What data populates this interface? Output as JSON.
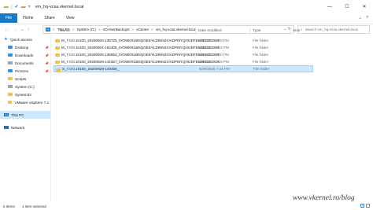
{
  "window": {
    "title": "vm_hq-vcsa.vkernel.local",
    "controls": {
      "minimize": "—",
      "maximize": "☐",
      "close": "✕"
    }
  },
  "quick_access_toolbar": {
    "icons": [
      "folder-icon",
      "check-icon",
      "folder-icon"
    ],
    "divider": "|",
    "dropdown": "▾"
  },
  "ribbon": {
    "tabs": [
      "File",
      "Home",
      "Share",
      "View"
    ],
    "expand_icon": "⌄",
    "help_icon": "?"
  },
  "navigation": {
    "back": "←",
    "forward": "→",
    "history": "⌄",
    "up": "↑"
  },
  "address_bar": {
    "segments": [
      "This PC",
      "System (C:)",
      "vCenterBackups",
      "vCenter",
      "vm_hq-vcsa.vkernel.local"
    ],
    "separator": ">",
    "dropdown": "⌄",
    "refresh": "↻"
  },
  "search": {
    "placeholder": "Search vm_hq-vcsa.vkernel.local"
  },
  "sidebar": {
    "items": [
      {
        "label": "Quick access",
        "icon": "star-icon",
        "level": 1
      },
      {
        "label": "Desktop",
        "icon": "desktop-icon",
        "level": 2,
        "pinned": true
      },
      {
        "label": "Downloads",
        "icon": "downloads-icon",
        "level": 2,
        "pinned": true
      },
      {
        "label": "Documents",
        "icon": "documents-icon",
        "level": 2,
        "pinned": true
      },
      {
        "label": "Pictures",
        "icon": "pictures-icon",
        "level": 2,
        "pinned": true
      },
      {
        "label": "Scripts",
        "icon": "folder-icon",
        "level": 2
      },
      {
        "label": "System (C:)",
        "icon": "drive-icon",
        "level": 2
      },
      {
        "label": "System32",
        "icon": "folder-icon",
        "level": 2
      },
      {
        "label": "VMware vSphere 7.x",
        "icon": "folder-icon",
        "level": 2
      },
      {
        "label": "This PC",
        "icon": "pc-icon",
        "level": 1,
        "selected": true
      },
      {
        "label": "Network",
        "icon": "network-icon",
        "level": 1
      }
    ],
    "pin_glyph": "📌"
  },
  "file_list": {
    "columns": {
      "name": "Name",
      "date": "Date modified",
      "type": "Type",
      "size": "Size"
    },
    "sort_indicator": "^",
    "rows": [
      {
        "name": "M_7.0.0.10100_20200920-135725_IVOWKRLBNQGEEYLDINN2XAIDPMYQHI2DFEB3EGZLOOR[EXICT...",
        "date": "9/20/2020 8:00 PM",
        "type": "File folder",
        "selected": false
      },
      {
        "name": "M_7.0.0.10100_20200924-152305_IVOWKRLBNQGEEYLDINN2XAIDPMYQHI2DFEB3EGZLOOR[EXICT...",
        "date": "9/24/2020 8:24 PM",
        "type": "File folder",
        "selected": false
      },
      {
        "name": "M_7.0.0.10100_20200925-135652_IVOWKRLBNQGEEYLDINN2XAIDPMYQHI2DFEB3EGZLOOR[EXICT...",
        "date": "9/25/2020 8:00 PM",
        "type": "File folder",
        "selected": false
      },
      {
        "name": "M_7.0.0.10100_20200929-141557_IVOWKRLBNQGEEYLDINN2XAIDPMYQHI2DFEB3EGZLOOR[EXICT...",
        "date": "9/29/2020 7:16 PM",
        "type": "File folder",
        "selected": false
      },
      {
        "name": "S_7.0.0.10100_20200929-143406_",
        "date": "9/29/2020 7:34 PM",
        "type": "File folder",
        "selected": true
      }
    ]
  },
  "status": {
    "items_count": "5 items",
    "selected_count": "1 item selected"
  },
  "watermark": "www.vkernel.ro/blog",
  "colors": {
    "accent": "#1979ca",
    "selection": "#cce8ff",
    "folder": "#f0c24d"
  }
}
